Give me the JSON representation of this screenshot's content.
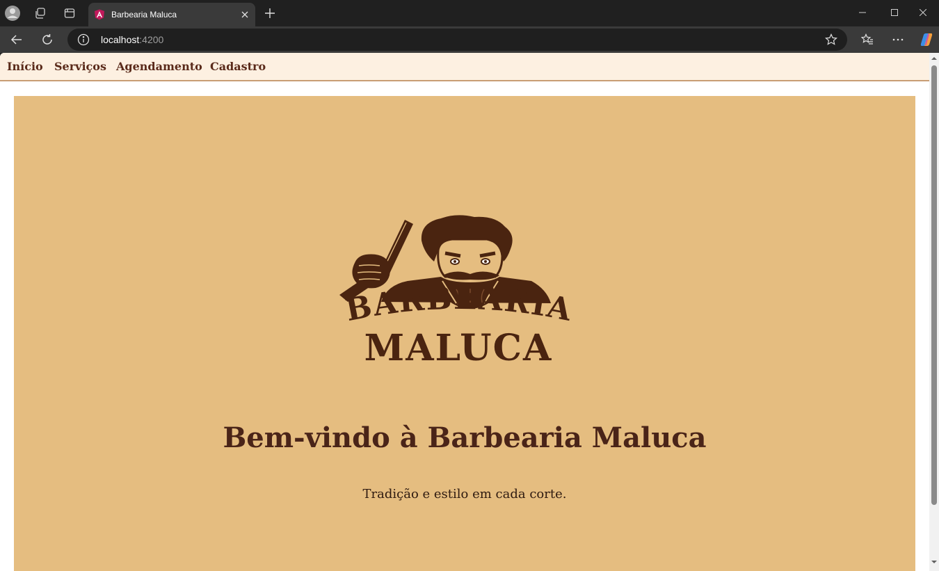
{
  "browser": {
    "tab_title": "Barbearia Maluca",
    "url_host": "localhost",
    "url_port": ":4200"
  },
  "icons": {
    "profile": "profile-avatar-icon",
    "workspaces": "workspaces-icon",
    "tab_actions": "tab-actions-icon",
    "favicon": "angular-favicon-icon",
    "close": "close-icon",
    "new_tab": "plus-icon",
    "minimize": "minimize-icon",
    "maximize": "maximize-icon",
    "window_close": "close-icon",
    "back": "arrow-left-icon",
    "refresh": "refresh-icon",
    "site_info": "info-icon",
    "favorite": "star-icon",
    "favorites": "favorites-icon",
    "more": "more-icon",
    "copilot": "copilot-icon"
  },
  "nav": {
    "items": [
      {
        "label": "Início"
      },
      {
        "label": "Serviços"
      },
      {
        "label": "Agendamento"
      },
      {
        "label": "Cadastro"
      }
    ]
  },
  "hero": {
    "logo_line1": "BARBEARIA",
    "logo_line2": "MALUCA",
    "title": "Bem-vindo à Barbearia Maluca",
    "subtitle": "Tradição e estilo em cada corte."
  },
  "colors": {
    "nav_bg": "#fdf0e1",
    "nav_text": "#5a2a1a",
    "hero_bg": "#e5bd80",
    "title_text": "#4a2418",
    "logo_brown": "#4a2410"
  }
}
